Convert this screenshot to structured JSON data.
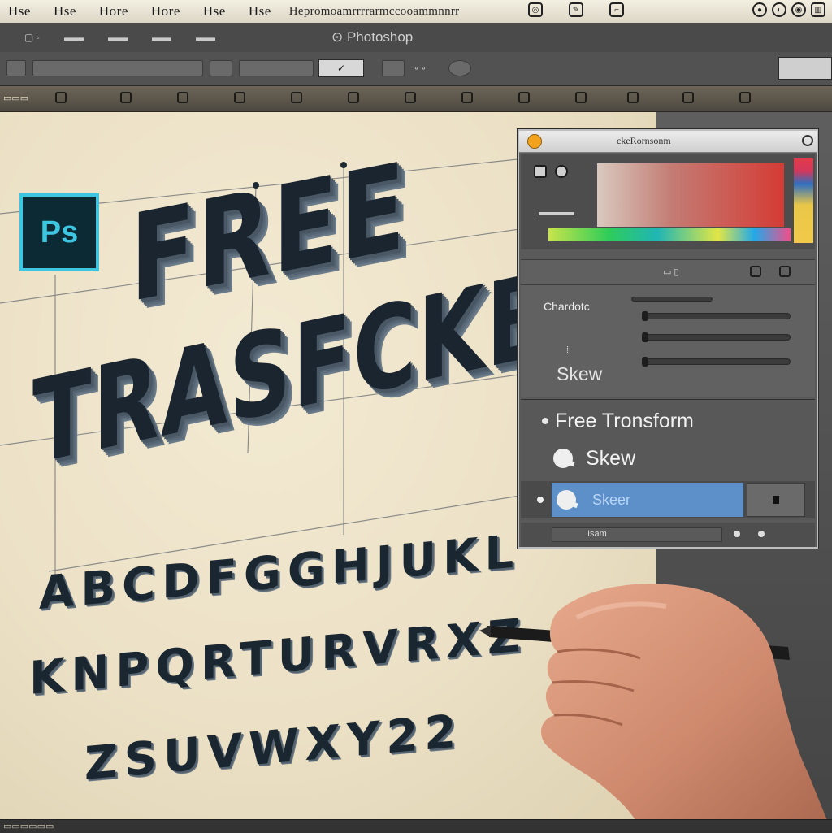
{
  "menubar": {
    "items": [
      "Hse",
      "Hse",
      "Hore",
      "Hore",
      "Hse",
      "Hse"
    ],
    "long_item": "Hepromoamrrrrarmccooammnnrr"
  },
  "appbar": {
    "title": "Photoshop"
  },
  "canvas": {
    "logo_text": "Ps",
    "word_1": "FREE",
    "word_2": "TRASFCKB",
    "alphabet_rows": [
      "ABCDFGGHJUKL",
      "KNPQRTURVRXZ",
      "ZSUVWXY22"
    ]
  },
  "panel": {
    "title": "ckeRornsonm",
    "section_label": "Chardotc",
    "skew_label": "Skew",
    "menu": [
      {
        "label": "Free Tronsform"
      },
      {
        "label": "Skew"
      }
    ],
    "selected_item": "Skeer",
    "footer_text": "Isam"
  },
  "colors": {
    "ps_accent": "#3ec6e0",
    "selection": "#5d8fc9",
    "title_dot": "#f2a21d"
  }
}
